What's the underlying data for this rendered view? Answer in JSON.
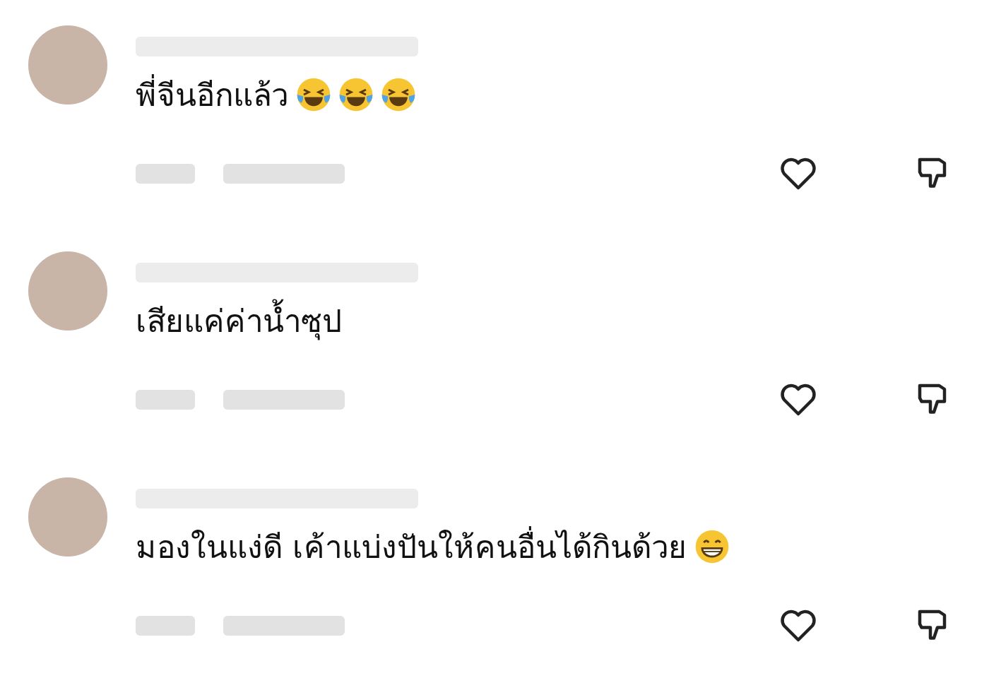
{
  "comments": [
    {
      "text": "พี่จีนอีกแล้ว",
      "emojis": [
        {
          "kind": "tears_of_joy"
        },
        {
          "kind": "tears_of_joy"
        },
        {
          "kind": "tears_of_joy"
        }
      ]
    },
    {
      "text": "เสียแค่ค่าน้ำซุป"
    },
    {
      "text": "มองในแง่ดี เค้าแบ่งปันให้คนอื่นได้กินด้วย",
      "emojis": [
        {
          "kind": "grin"
        }
      ]
    }
  ]
}
